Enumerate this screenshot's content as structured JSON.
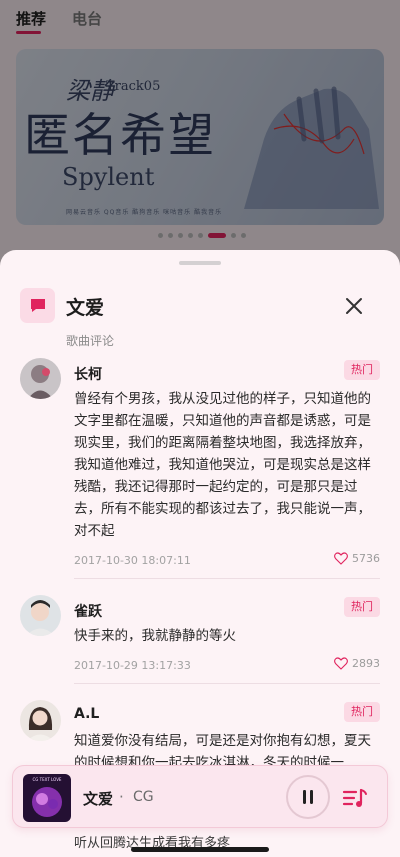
{
  "top_tabs": [
    {
      "label": "推荐"
    },
    {
      "label": "电台"
    }
  ],
  "banner": {
    "artist_script": "梁静",
    "track": "Track05",
    "title": "匿名希望",
    "subtitle": "Spylent",
    "partners": "网易云音乐  QQ音乐  酷狗音乐  咪咕音乐  酷我音乐"
  },
  "sheet": {
    "title": "文爱",
    "subtitle": "歌曲评论",
    "icon": "chat-bubble-icon",
    "close_icon": "close-icon"
  },
  "comments": [
    {
      "user": "长柯",
      "badge": "热门",
      "text": "曾经有个男孩，我从没见过他的样子，只知道他的文字里都在温暖，只知道他的声音都是诱惑，可是现实里，我们的距离隔着整块地图，我选择放弃，我知道他难过，我知道他哭泣，可是现实总是这样残酷，我还记得那时一起约定的，可是那只是过去，所有不能实现的都该过去了，我只能说一声，对不起",
      "time": "2017-10-30 18:07:11",
      "likes": "5736"
    },
    {
      "user": "雀跃",
      "badge": "热门",
      "text": "快手来的，我就静静的等火",
      "time": "2017-10-29 13:17:33",
      "likes": "2893"
    },
    {
      "user": "A.L",
      "badge": "热门",
      "text": "知道爱你没有结局，可是还是对你抱有幻想，夏天的时候想和你一起去吃冰淇淋，冬天的时候一",
      "time": "",
      "likes": ""
    }
  ],
  "player": {
    "title": "文爱",
    "separator": "·",
    "artist": "CG",
    "cover_text": "CG TEXT LOVE",
    "pause_icon": "pause-icon",
    "queue_icon": "playlist-icon"
  },
  "peek_text": "听从回腾达生成看我有多疼",
  "colors": {
    "accent": "#e0245e",
    "sheet_bg": "#fdf3f6",
    "badge_bg": "#fbd9e4"
  }
}
